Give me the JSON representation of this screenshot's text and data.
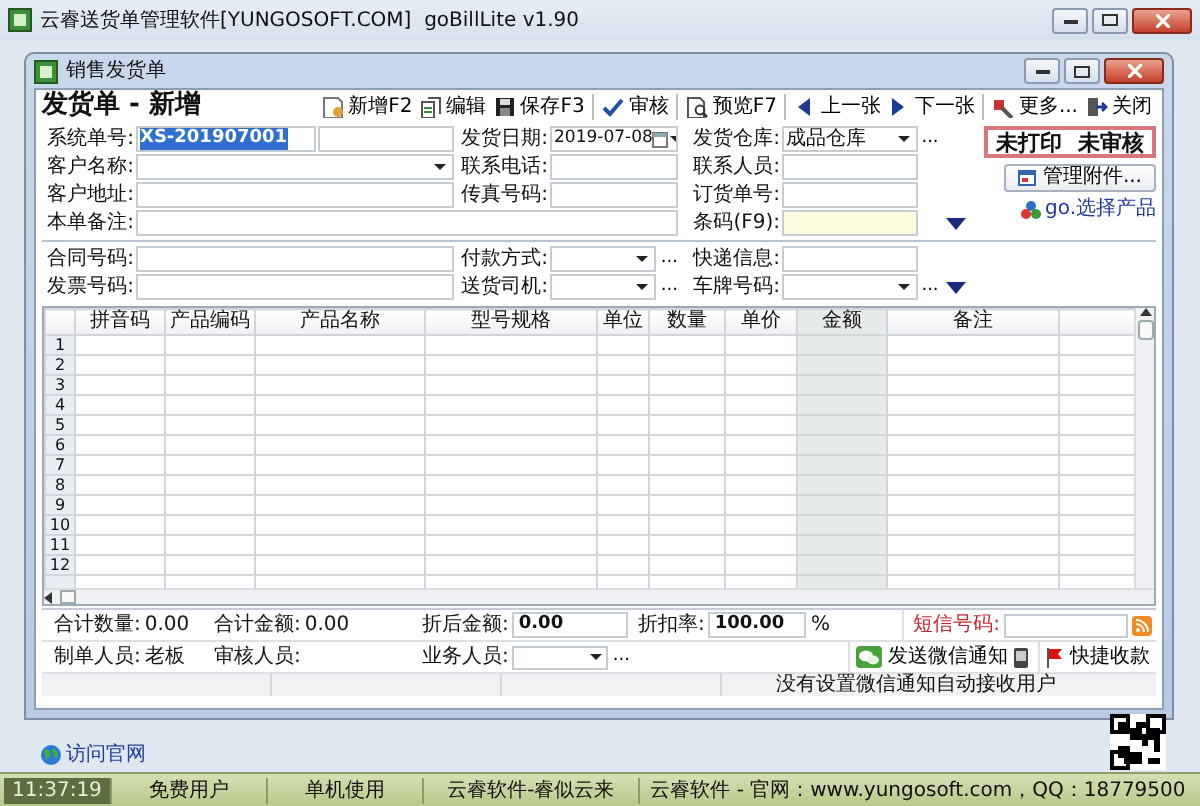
{
  "window": {
    "title": "云睿送货单管理软件[YUNGOSOFT.COM]  goBillLite v1.90"
  },
  "child_window": {
    "title": "销售发货单"
  },
  "form": {
    "title": "发货单 - 新增",
    "toolbar": [
      {
        "label": "新增F2",
        "separator_before": false
      },
      {
        "label": "编辑",
        "separator_before": false
      },
      {
        "label": "保存F3",
        "separator_before": false
      },
      {
        "label": "审核",
        "separator_before": true
      },
      {
        "label": "预览F7",
        "separator_before": true
      },
      {
        "label": "上一张",
        "separator_before": true
      },
      {
        "label": "下一张",
        "separator_before": false
      },
      {
        "label": "更多...",
        "separator_before": true
      },
      {
        "label": "关闭",
        "separator_before": false
      }
    ],
    "field_rows": [
      [
        {
          "kind": "text",
          "label": "系统单号:",
          "value": "XS-201907001",
          "highlighted": true
        },
        {
          "kind": "text"
        },
        {
          "kind": "date",
          "label": "发货日期:",
          "value": "2019-07-08"
        },
        {
          "kind": "select",
          "label": "发货仓库:",
          "value": "成品仓库",
          "more": "..."
        }
      ],
      [
        {
          "kind": "select",
          "label": "客户名称:"
        },
        {
          "kind": "text",
          "label": "联系电话:"
        },
        {
          "kind": "text",
          "label": "联系人员:"
        }
      ],
      [
        {
          "kind": "text",
          "label": "客户地址:"
        },
        {
          "kind": "text",
          "label": "传真号码:"
        },
        {
          "kind": "text",
          "label": "订货单号:"
        }
      ],
      [
        {
          "kind": "text",
          "label": "本单备注:"
        },
        {
          "kind": "barcode",
          "label": "条码(F9):"
        },
        {
          "kind": "expand"
        }
      ],
      [
        {
          "kind": "text",
          "label": "合同号码:"
        },
        {
          "kind": "select",
          "label": "付款方式:",
          "more": "..."
        },
        {
          "kind": "text",
          "label": "快递信息:"
        }
      ],
      [
        {
          "kind": "text",
          "label": "发票号码:"
        },
        {
          "kind": "select",
          "label": "送货司机:",
          "more": "..."
        },
        {
          "kind": "select",
          "label": "车牌号码:",
          "more": "..."
        },
        {
          "kind": "expand"
        }
      ]
    ],
    "side": {
      "print_status": "未打印",
      "audit_status": "未审核",
      "attach_button": "管理附件...",
      "select_link": "go.选择产品"
    },
    "grid": {
      "columns": [
        {
          "label": "拼音码",
          "shaded": false
        },
        {
          "label": "产品编码",
          "shaded": false
        },
        {
          "label": "产品名称",
          "shaded": false
        },
        {
          "label": "型号规格",
          "shaded": false
        },
        {
          "label": "单位",
          "shaded": false
        },
        {
          "label": "数量",
          "shaded": false
        },
        {
          "label": "单价",
          "shaded": false
        },
        {
          "label": "金额",
          "shaded": true
        },
        {
          "label": "备注",
          "shaded": false
        }
      ],
      "rows": [
        "1",
        "2",
        "3",
        "4",
        "5",
        "6",
        "7",
        "8",
        "9",
        "10",
        "11",
        "12"
      ]
    },
    "summary": {
      "row_1": [
        {
          "kind": "static",
          "label": "合计数量:",
          "value": "0.00"
        },
        {
          "kind": "static",
          "label": "合计金额:",
          "value": "0.00"
        },
        {
          "kind": "input",
          "label": "折后金额:",
          "value": "0.00"
        },
        {
          "kind": "input",
          "label": "折扣率:",
          "value": "100.00",
          "suffix": "%"
        }
      ],
      "sms": {
        "label": "短信号码:"
      },
      "row_2": [
        {
          "kind": "static",
          "label": "制单人员:",
          "value": "老板"
        },
        {
          "kind": "static",
          "label": "审核人员:"
        },
        {
          "kind": "select",
          "label": "业务人员:",
          "more": "..."
        }
      ],
      "wechat_button": "发送微信通知",
      "pay_button": "快捷收款",
      "message": "没有设置微信通知自动接收用户"
    }
  },
  "footer": {
    "link": "访问官网"
  },
  "status_bar": [
    "11:37:19",
    "免费用户",
    "单机使用",
    "云睿软件-睿似云来",
    "云睿软件 - 官网：www.yungosoft.com，QQ：18779500"
  ]
}
